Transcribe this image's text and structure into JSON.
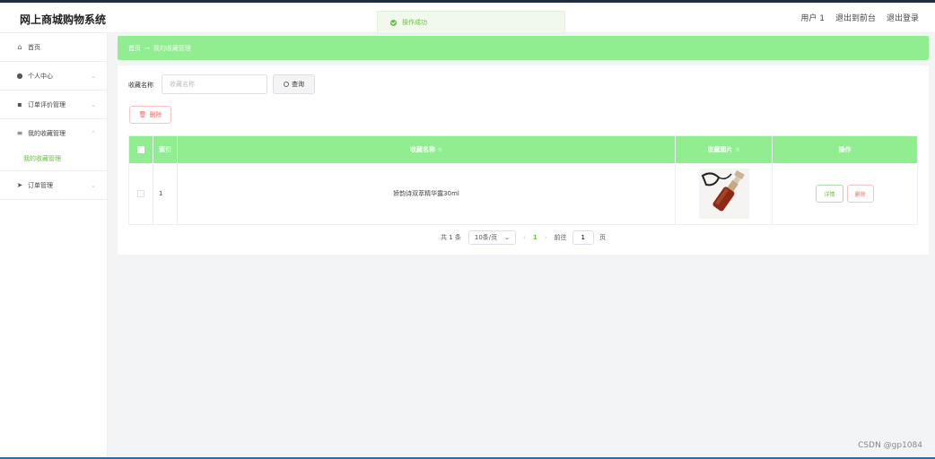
{
  "app": {
    "title": "网上商城购物系统"
  },
  "header": {
    "user": "用户 1",
    "exit_front": "退出到前台",
    "logout": "退出登录"
  },
  "toast": {
    "message": "操作成功",
    "color": "#67c23a"
  },
  "sidebar": {
    "items": [
      {
        "label": "首页",
        "icon": "home-icon"
      },
      {
        "label": "个人中心",
        "icon": "user-icon"
      },
      {
        "label": "订单评价管理",
        "icon": "trash-icon"
      },
      {
        "label": "我的收藏管理",
        "icon": "sort-icon"
      },
      {
        "label": "订单管理",
        "icon": "send-icon"
      }
    ],
    "submenu": {
      "label": "我的收藏管理"
    }
  },
  "breadcrumb": {
    "home": "首页",
    "arrow": "→",
    "current": "我的收藏管理"
  },
  "search": {
    "label": "收藏名称",
    "placeholder": "收藏名称",
    "button": "查询"
  },
  "actions": {
    "delete": "删除"
  },
  "table": {
    "columns": {
      "index": "索引",
      "name": "收藏名称",
      "image": "收藏图片",
      "ops": "操作"
    },
    "rows": [
      {
        "index": "1",
        "name": "娇韵诗双萃精华露30ml",
        "image": "perfume-product-image",
        "detail": "详情",
        "delete": "删除"
      }
    ]
  },
  "pagination": {
    "total": "共 1 条",
    "page_size": "10条/页",
    "current": "1",
    "goto_prefix": "前往",
    "goto_value": "1",
    "goto_suffix": "页"
  },
  "watermark": "CSDN @gp1084",
  "colors": {
    "accent": "#90ee90",
    "success": "#67c23a",
    "danger": "#f56c6c"
  }
}
